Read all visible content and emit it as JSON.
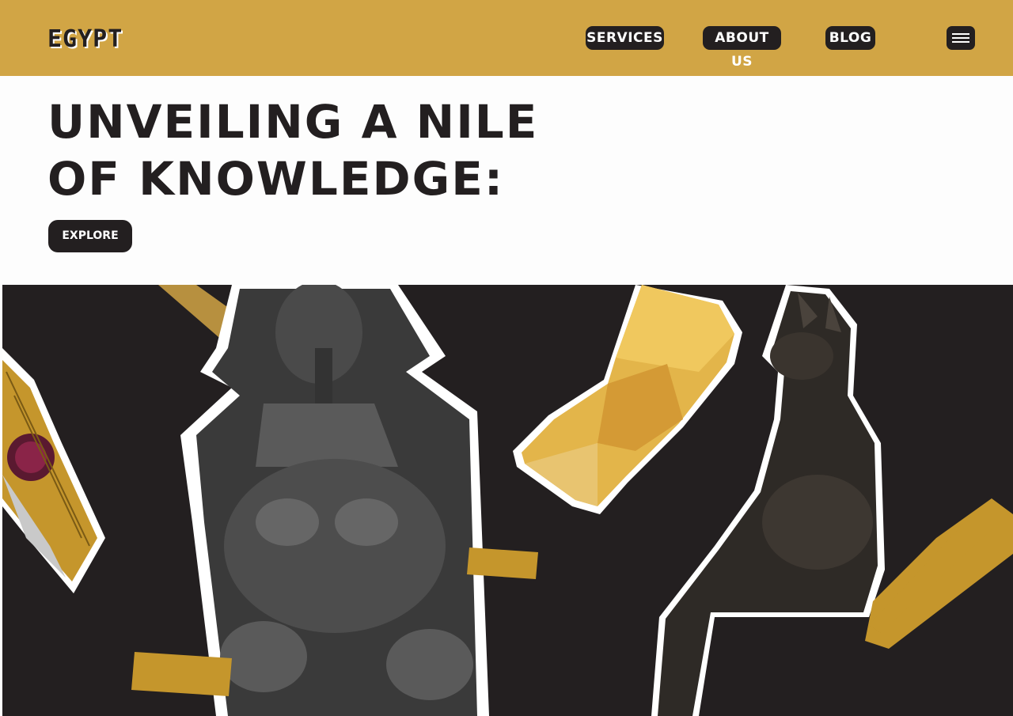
{
  "header": {
    "logo": "EGYPT",
    "nav": {
      "services": "SERVICES",
      "about": "ABOUT US",
      "blog": "BLOG"
    },
    "menu_icon": "hamburger-menu-icon"
  },
  "hero_text": {
    "headline": "UNVEILING A NILE\nOF KNOWLEDGE:",
    "explore": "EXPLORE"
  },
  "colors": {
    "gold": "#d1a545",
    "dark": "#231f20",
    "white": "#fdfdfd"
  }
}
